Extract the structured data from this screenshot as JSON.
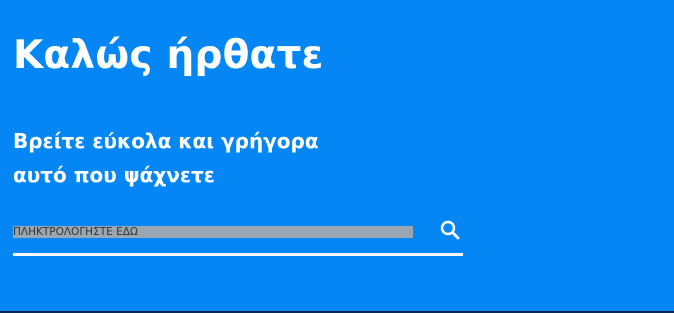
{
  "hero": {
    "title": "Καλώς ήρθατε",
    "subtitle_line1": "Βρείτε εύκολα και γρήγορα",
    "subtitle_line2": "αυτό που ψάχνετε"
  },
  "search": {
    "placeholder": "ΠΛΗΚΤΡΟΛΟΓΗΣΤΕ ΕΔΩ",
    "value": "",
    "icon": "search-icon"
  },
  "colors": {
    "background": "#0586f5",
    "text": "#ffffff",
    "divider": "#0a2a55"
  }
}
